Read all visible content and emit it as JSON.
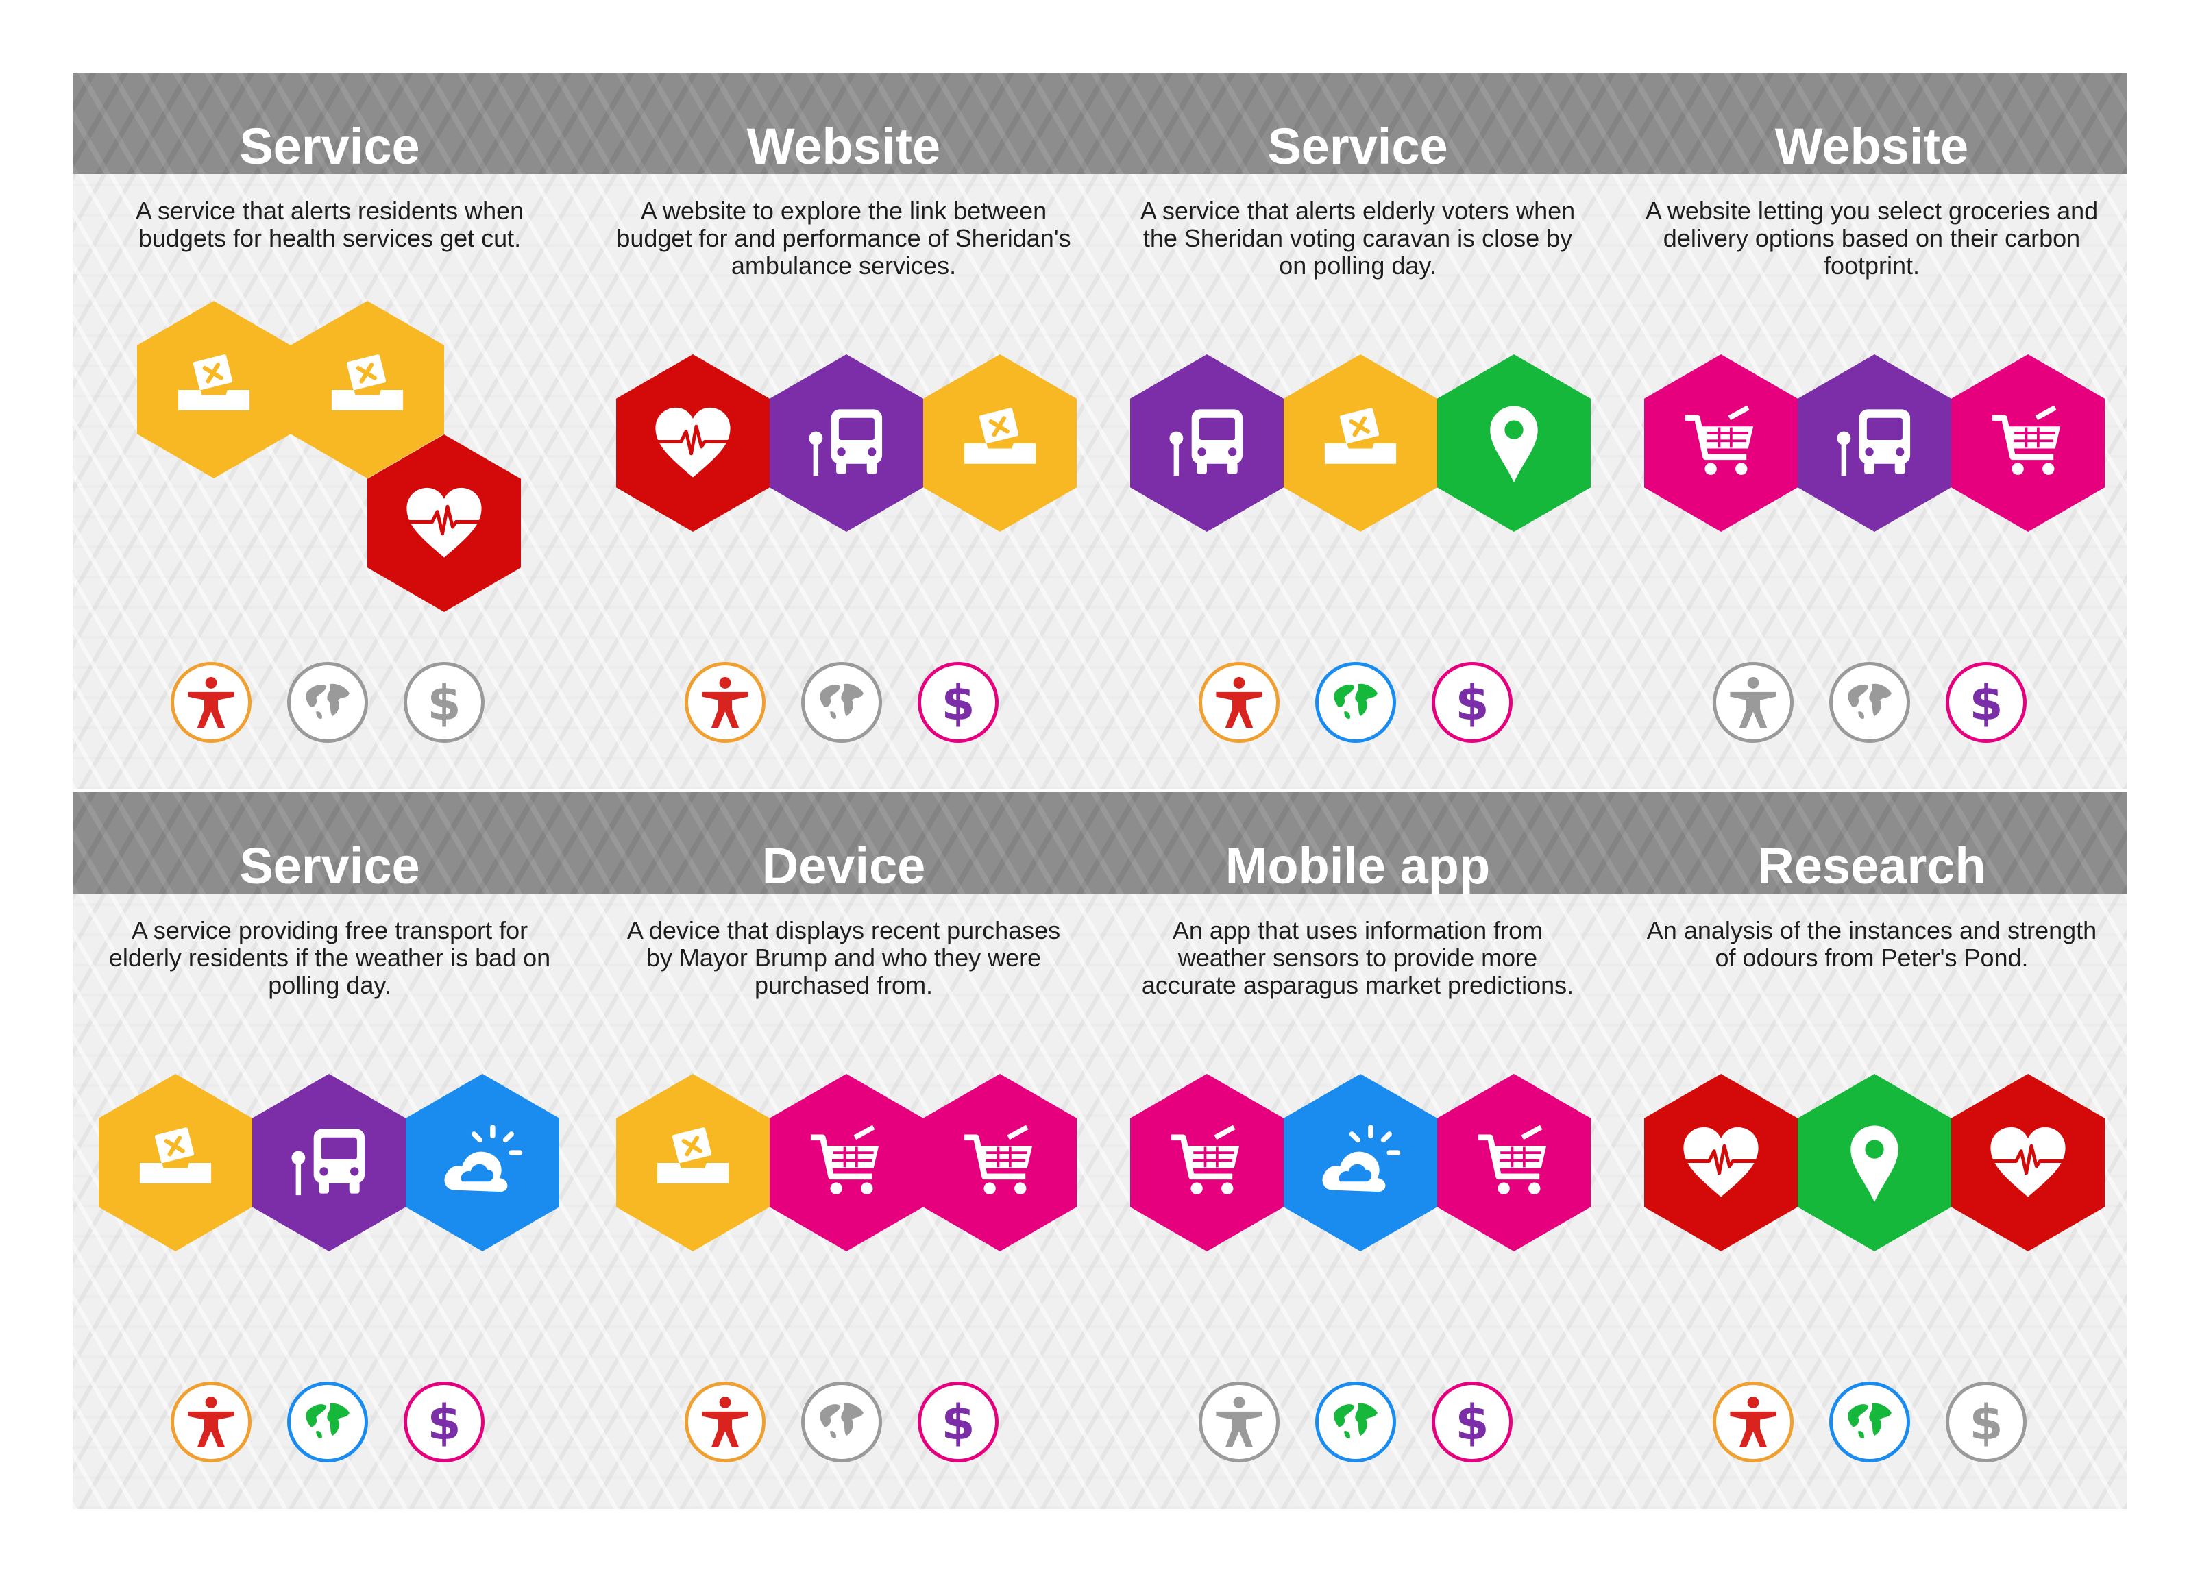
{
  "palette": {
    "voting": "#f8b824",
    "health": "#d40a0a",
    "transport": "#7b2ea8",
    "location": "#15b83a",
    "shopping": "#e6007e",
    "weather": "#1a8cf0",
    "people": "#d8231f",
    "people_ring": "#f0a030",
    "globe_ring": "#1a8cf0",
    "money": "#7b2ea8",
    "money_ring": "#e6007e",
    "inactive": "#9a9a9a"
  },
  "rows": [
    {
      "cards": [
        {
          "title": "Service",
          "description": "A service that alerts residents when budgets for health services get cut.",
          "hexes": [
            "ballot-box-icon",
            "ballot-box-icon",
            "heart-pulse-icon"
          ],
          "badges": {
            "people": true,
            "environment": false,
            "money": false
          }
        },
        {
          "title": "Website",
          "description": "A website to explore the link between budget for and performance of Sheridan's ambulance services.",
          "hexes": [
            "heart-pulse-icon",
            "bus-icon",
            "ballot-box-icon"
          ],
          "badges": {
            "people": true,
            "environment": false,
            "money": true
          }
        },
        {
          "title": "Service",
          "description": "A service that alerts elderly voters when the Sheridan voting caravan is close by on polling day.",
          "hexes": [
            "bus-icon",
            "ballot-box-icon",
            "map-pin-icon"
          ],
          "badges": {
            "people": true,
            "environment": true,
            "money": true
          }
        },
        {
          "title": "Website",
          "description": "A website letting you select groceries and delivery options based on their carbon footprint.",
          "hexes": [
            "shopping-cart-icon",
            "bus-icon",
            "shopping-cart-icon"
          ],
          "badges": {
            "people": false,
            "environment": false,
            "money": true
          }
        }
      ]
    },
    {
      "cards": [
        {
          "title": "Service",
          "description": "A service providing free transport for elderly residents if the weather is bad on polling day.",
          "hexes": [
            "ballot-box-icon",
            "bus-icon",
            "weather-icon"
          ],
          "badges": {
            "people": true,
            "environment": true,
            "money": true
          }
        },
        {
          "title": "Device",
          "description": "A device that displays recent purchases by Mayor Brump and who they were purchased from.",
          "hexes": [
            "ballot-box-icon",
            "shopping-cart-icon",
            "shopping-cart-icon"
          ],
          "badges": {
            "people": true,
            "environment": false,
            "money": true
          }
        },
        {
          "title": "Mobile app",
          "description": "An app that uses information from weather sensors to provide more accurate asparagus market predictions.",
          "hexes": [
            "shopping-cart-icon",
            "weather-icon",
            "shopping-cart-icon"
          ],
          "badges": {
            "people": false,
            "environment": true,
            "money": true
          }
        },
        {
          "title": "Research",
          "description": "An analysis of the instances and strength of odours from Peter's Pond.",
          "hexes": [
            "heart-pulse-icon",
            "map-pin-icon",
            "heart-pulse-icon"
          ],
          "badges": {
            "people": true,
            "environment": true,
            "money": false
          }
        }
      ]
    }
  ]
}
